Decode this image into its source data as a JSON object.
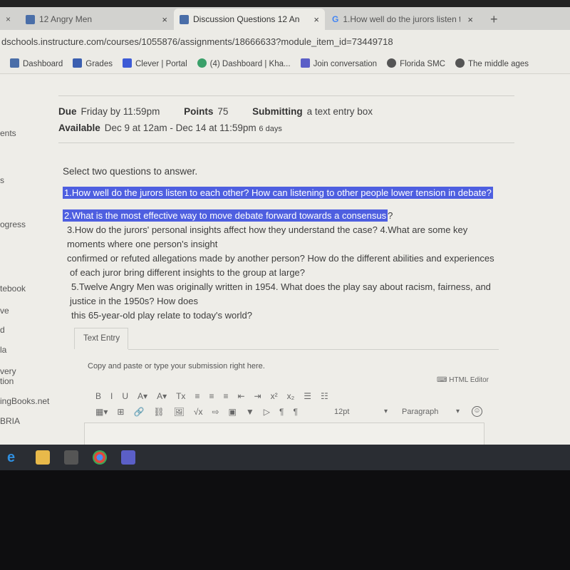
{
  "browser": {
    "tabs": [
      {
        "title": "12 Angry Men"
      },
      {
        "title": "Discussion Questions 12 Angry M"
      },
      {
        "title": "1.How well do the jurors listen to"
      }
    ],
    "url": "dschools.instructure.com/courses/1055876/assignments/18666633?module_item_id=73449718",
    "bookmarks": [
      "Dashboard",
      "Grades",
      "Clever | Portal",
      "(4) Dashboard | Kha...",
      "Join conversation",
      "Florida SMC",
      "The middle  ages"
    ]
  },
  "sidebar": [
    "ents",
    "s",
    "ogress",
    "tebook",
    "ve",
    "d",
    "la",
    "very",
    "tion",
    "ingBooks.net",
    "BRIA"
  ],
  "assignment": {
    "due_label": "Due",
    "due": "Friday by 11:59pm",
    "points_label": "Points",
    "points": "75",
    "submitting_label": "Submitting",
    "submitting": "a text entry box",
    "available_label": "Available",
    "available": "Dec 9 at 12am - Dec 14 at 11:59pm",
    "available_days": "6 days"
  },
  "instructions": "Select two questions to answer.",
  "questions": [
    "1.How well do the jurors listen to each other? How can listening to other people lower tension in debate?",
    "2.What is the most effective way to move debate forward towards a consensus",
    "?",
    "3.How do the jurors' personal insights affect how they understand the case? 4.What are some key",
    "moments where one person's insight",
    "confirmed or refuted allegations made by another person? How do the different abilities and experiences",
    "of each juror bring different insights to the group at large?",
    "5.Twelve Angry Men was originally written in 1954. What does the play say about racism, fairness, and",
    "justice in the 1950s? How does",
    "this 65-year-old play relate to today's world?"
  ],
  "editor": {
    "tab": "Text Entry",
    "hint": "Copy and paste or type your submission right here.",
    "html_editor": "HTML Editor",
    "font_size": "12pt",
    "block_format": "Paragraph",
    "row1": [
      "B",
      "I",
      "U",
      "A▾",
      "A▾",
      "Tx",
      "≡",
      "≡",
      "≡",
      "⇤",
      "⇥",
      "x²",
      "x₂",
      "☰",
      "☷"
    ],
    "row2": [
      "▦▾",
      "⊞",
      "🔗",
      "⛓",
      "🖼",
      "√x",
      "⇨",
      "▣",
      "▼",
      "▷",
      "¶",
      "¶"
    ]
  }
}
